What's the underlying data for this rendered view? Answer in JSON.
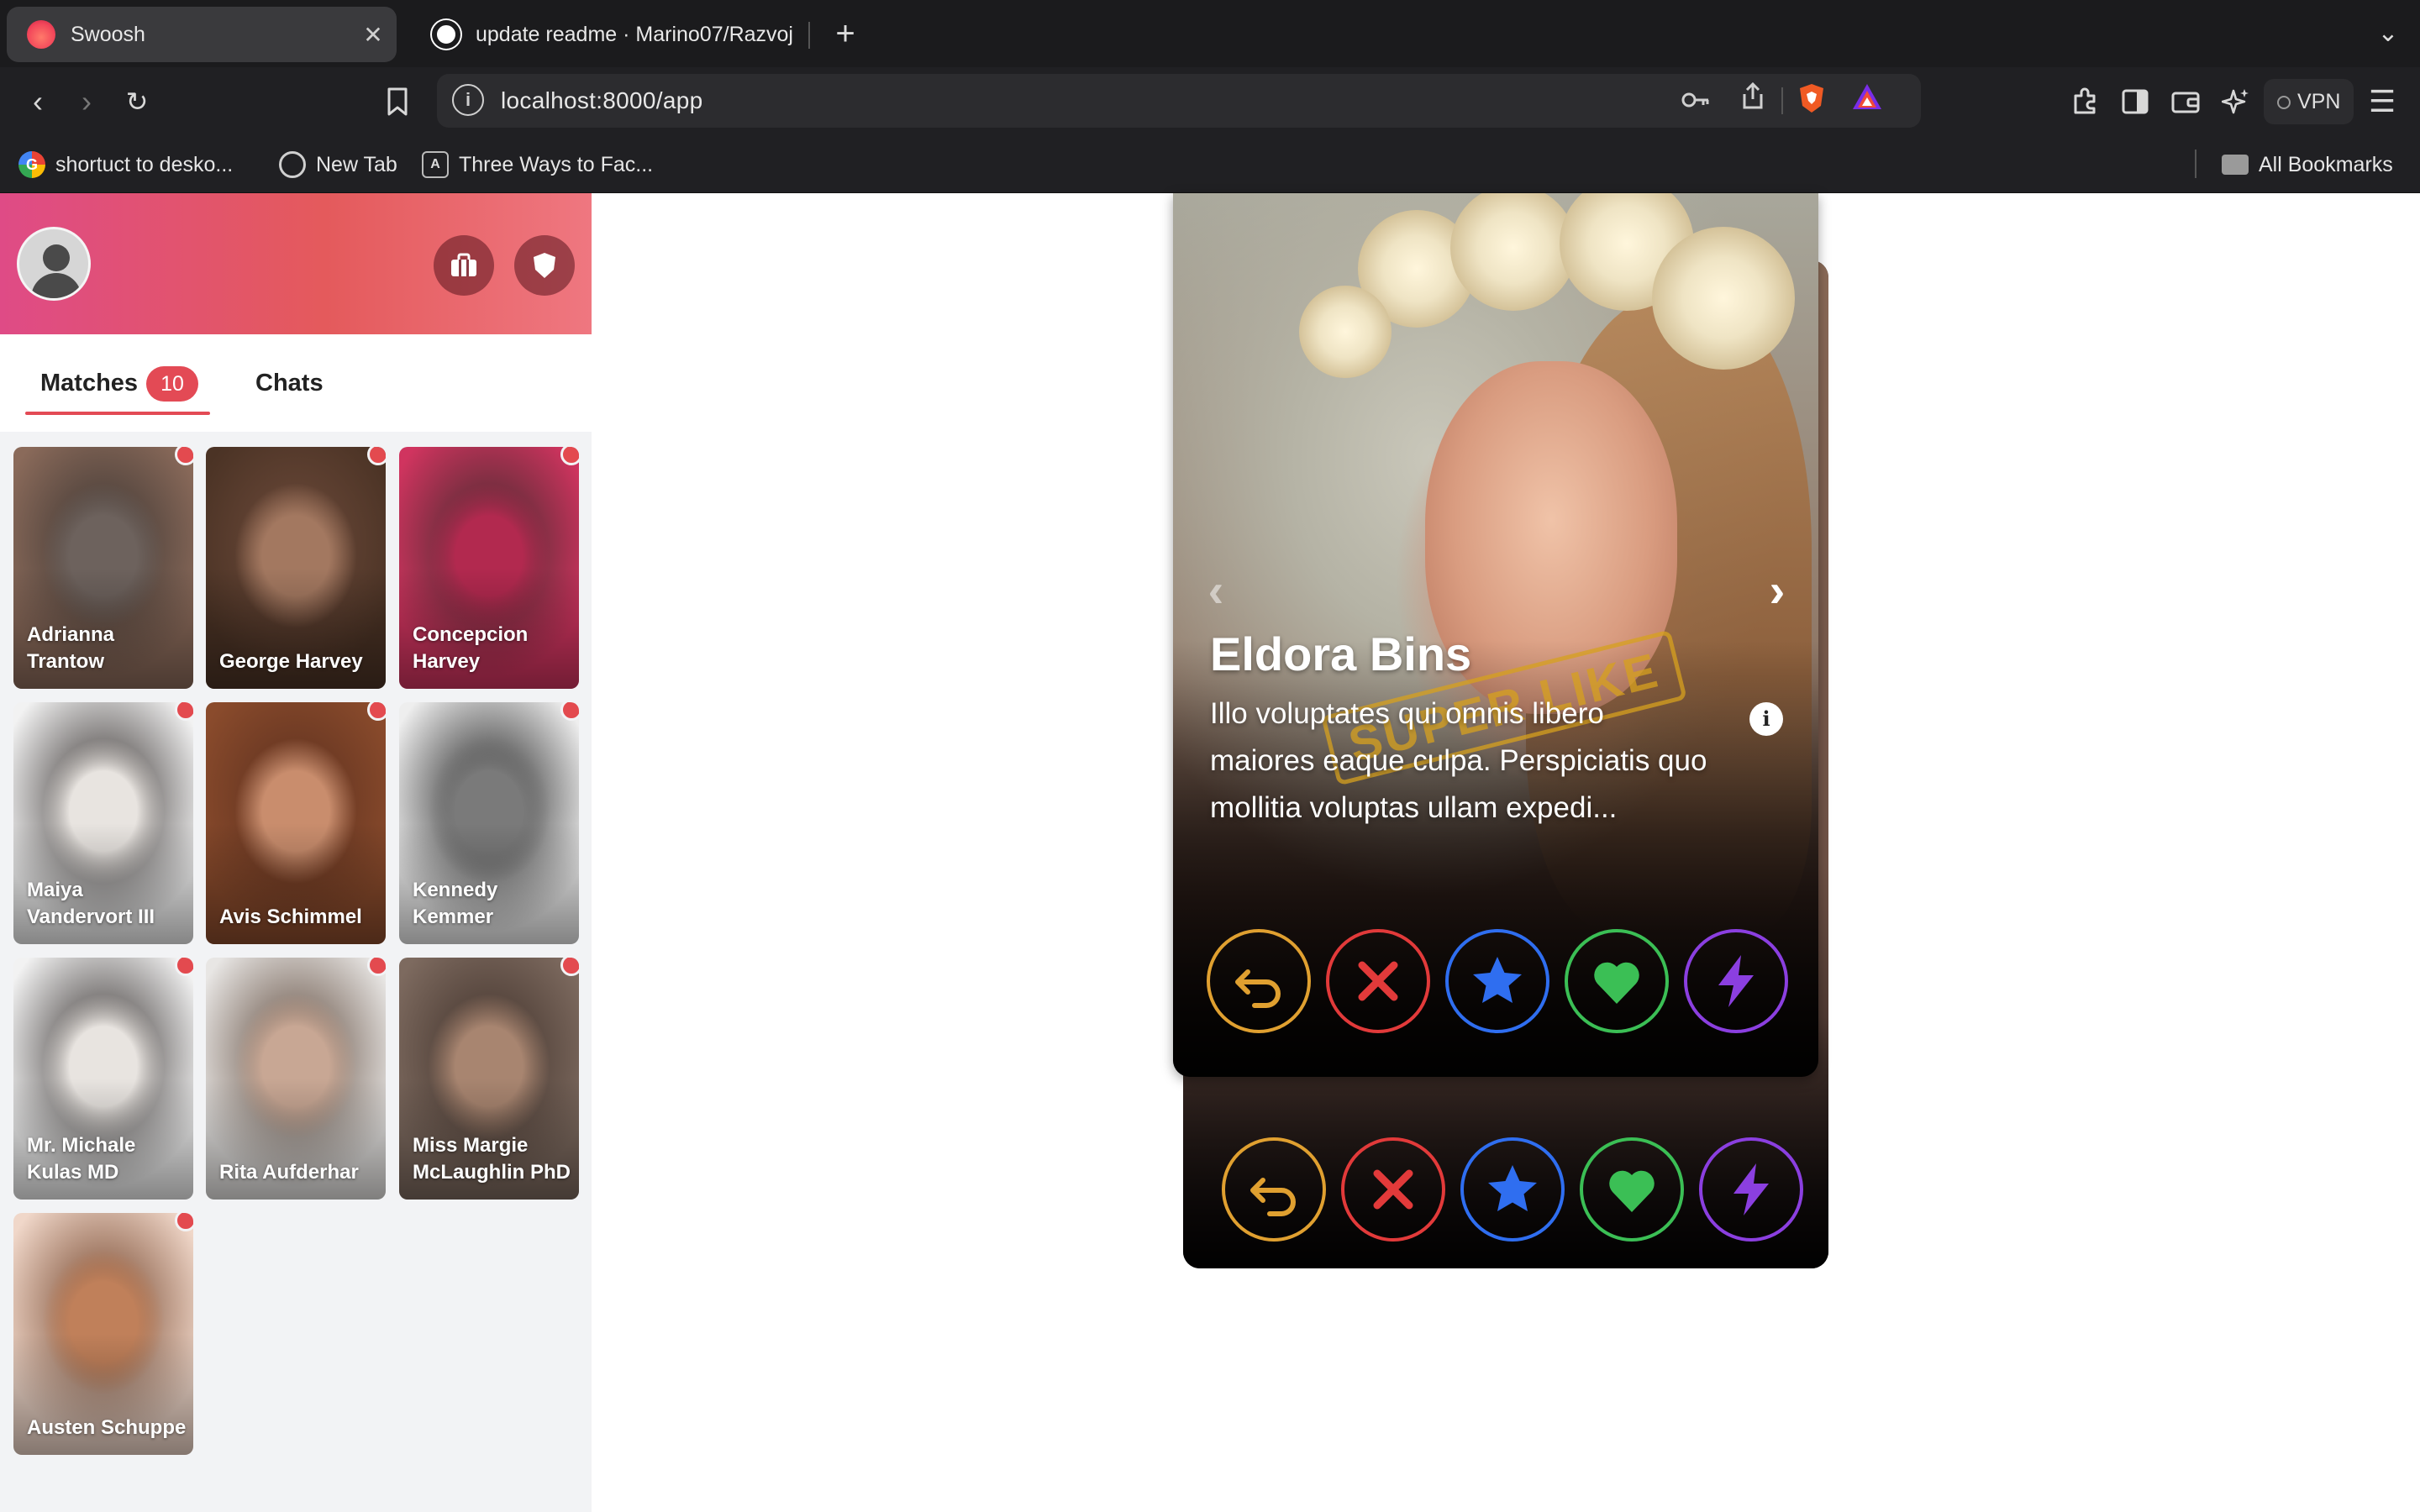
{
  "browser": {
    "tabs": [
      {
        "title": "Swoosh",
        "active": true,
        "icon": "flame-icon",
        "close": "✕"
      },
      {
        "title": "update readme · Marino07/Razvoj",
        "active": false,
        "icon": "github-icon"
      }
    ],
    "new_tab": "+",
    "url": "localhost:8000/app",
    "vpn_label": "VPN",
    "bookmarks": [
      {
        "label": "shortuct to desko...",
        "icon": "google-icon"
      },
      {
        "label": "New Tab",
        "icon": "globe-icon"
      },
      {
        "label": "Three Ways to Fac...",
        "icon": "angular-icon"
      }
    ],
    "all_bookmarks": "All Bookmarks"
  },
  "sidebar": {
    "tabs": {
      "matches_label": "Matches",
      "matches_count": "10",
      "chats_label": "Chats"
    },
    "matches": [
      {
        "name": "Adrianna Trantow",
        "colors": [
          "#8a6a5a",
          "#6d625d",
          "#3a3431"
        ]
      },
      {
        "name": "George Harvey",
        "colors": [
          "#4b3325",
          "#a37860",
          "#6e4b3b"
        ]
      },
      {
        "name": "Concepcion Harvey",
        "colors": [
          "#d0345f",
          "#b2294f",
          "#3a2a2a"
        ]
      },
      {
        "name": "Maiya Vandervort III",
        "colors": [
          "#f2f2f2",
          "#e8e4e0",
          "#2c2624"
        ]
      },
      {
        "name": "Avis Schimmel",
        "colors": [
          "#8a4b2c",
          "#c98d6d",
          "#5b2f1e"
        ]
      },
      {
        "name": "Kennedy Kemmer",
        "colors": [
          "#eeeeee",
          "#7a7a7a",
          "#1a1a1a"
        ]
      },
      {
        "name": "Mr. Michale Kulas MD",
        "colors": [
          "#f2f2f2",
          "#e8e4e0",
          "#2c2624"
        ]
      },
      {
        "name": "Rita Aufderhar",
        "colors": [
          "#e8e6e4",
          "#c8a794",
          "#5a4436"
        ]
      },
      {
        "name": "Miss Margie McLaughlin PhD",
        "colors": [
          "#7d6a5f",
          "#a88570",
          "#3f3029"
        ]
      },
      {
        "name": "Austen Schuppe",
        "colors": [
          "#f0d7c9",
          "#c0805a",
          "#6e3e24"
        ]
      }
    ]
  },
  "card": {
    "name": "Eldora Bins",
    "bio": "Illo voluptates qui omnis libero maiores eaque culpa. Perspiciatis quo mollitia voluptas ullam expedi...",
    "stamp": "SUPER LIKE",
    "info_icon": "i",
    "prev_arrow": "‹",
    "next_arrow": "›"
  },
  "actions": [
    {
      "name": "rewind-button",
      "icon": "undo-icon",
      "color": "#e0a030"
    },
    {
      "name": "nope-button",
      "icon": "close-x-icon",
      "color": "#e23a3a"
    },
    {
      "name": "superlike-button",
      "icon": "star-icon",
      "color": "#2f6ef0"
    },
    {
      "name": "like-button",
      "icon": "heart-icon",
      "color": "#3bbf55"
    },
    {
      "name": "boost-button",
      "icon": "lightning-icon",
      "color": "#8b3fe0"
    }
  ],
  "colors": {
    "brand_pink": "#df4b86",
    "brand_red": "#e45a5c",
    "badge_red": "#e34a55"
  }
}
